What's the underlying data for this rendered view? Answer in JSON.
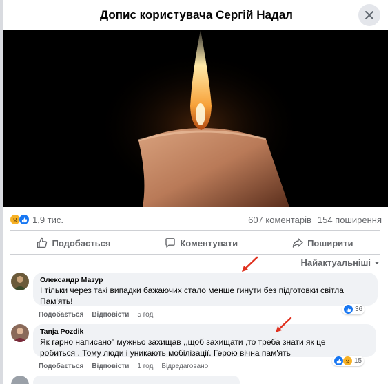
{
  "header": {
    "title": "Допис користувача Сергій Надал",
    "close_icon": "close-icon"
  },
  "photo": {
    "subject": "candle",
    "background": "#000000"
  },
  "stats": {
    "reactions_count": "1,9 тис.",
    "comments": "607 коментарів",
    "shares": "154 поширення"
  },
  "actions": {
    "like": "Подобається",
    "comment": "Коментувати",
    "share": "Поширити"
  },
  "sort": {
    "label": "Найактуальніші"
  },
  "comments": [
    {
      "author": "Олександр Мазур",
      "text_line1": "І тільки через такі випадки бажаючих стало менше гинути без підготовки світла",
      "text_line2": "Пам'ять!",
      "like": "Подобається",
      "reply": "Відповісти",
      "time": "5 год",
      "reactions": "36"
    },
    {
      "author": "Tanja Pozdik",
      "text_line1": "Як гарно написано\" мужньо захищав ,,щоб захищати ,то треба знати як це",
      "text_line2": "робиться . Тому люди і уникають мобілізації. Герою вічна пам'ять",
      "like": "Подобається",
      "reply": "Відповісти",
      "time": "1 год",
      "edited": "Відредаговано",
      "reactions": "15"
    }
  ],
  "colors": {
    "accent": "#1877f2",
    "secondary_text": "#65676b",
    "bubble": "#f0f2f5",
    "arrow": "#e0311f"
  }
}
